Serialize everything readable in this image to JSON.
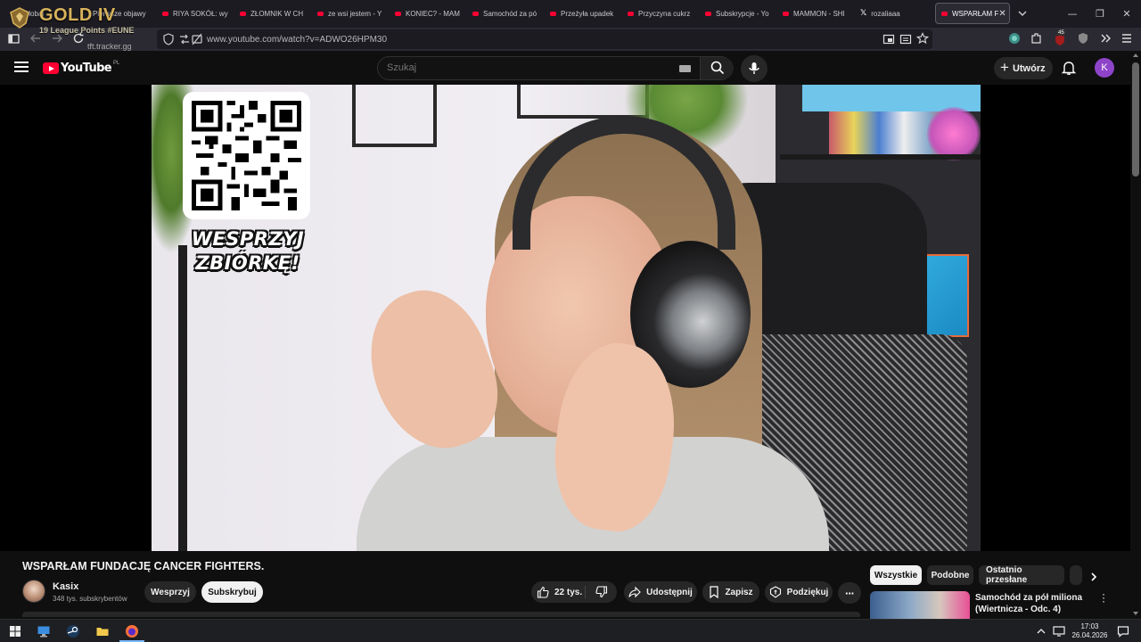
{
  "browser": {
    "tabs": [
      {
        "label": "Global",
        "type": "overlay"
      },
      {
        "label": "Pierwsze objawy",
        "type": "youtube"
      },
      {
        "label": "RIYA SOKÓŁ: wy",
        "type": "youtube"
      },
      {
        "label": "ZŁOMNIK W CH",
        "type": "youtube"
      },
      {
        "label": "ze wsi jestem - Y",
        "type": "youtube"
      },
      {
        "label": "KONIEC? - MAM",
        "type": "youtube"
      },
      {
        "label": "Samochód za pó",
        "type": "youtube"
      },
      {
        "label": "Przeżyła upadek",
        "type": "youtube"
      },
      {
        "label": "Przyczyna cukrz",
        "type": "youtube"
      },
      {
        "label": "Subskrypcje - Yo",
        "type": "youtube"
      },
      {
        "label": "MAMMON - SHI",
        "type": "youtube"
      },
      {
        "label": "rozaliaaa",
        "type": "x"
      },
      {
        "label": "WSPARŁAM F",
        "type": "youtube"
      }
    ],
    "active_tab_index": 12,
    "url": "www.youtube.com/watch?v=ADWO26HPM30",
    "tab_badge_count": "45"
  },
  "overlay": {
    "rank": "GOLD IV",
    "league_points": "19 League Points #EUNE",
    "site": "tft.tracker.gg"
  },
  "youtube": {
    "logo_text": "YouTube",
    "country_code": "PL",
    "search_placeholder": "Szukaj",
    "create_label": "Utwórz",
    "avatar_letter": "K"
  },
  "video": {
    "overlay_caption_line1": "WESPRZYJ",
    "overlay_caption_line2": "ZBIÓRKĘ!",
    "title": "WSPARŁAM FUNDACJĘ CANCER FIGHTERS.",
    "channel": "Kasix",
    "subscribers": "348 tys. subskrybentów",
    "support_label": "Wesprzyj",
    "subscribe_label": "Subskrybuj",
    "likes": "22 tys.",
    "share_label": "Udostępnij",
    "save_label": "Zapisz",
    "thanks_label": "Podziękuj"
  },
  "recommendations": {
    "chips": [
      "Wszystkie",
      "Podobne",
      "Ostatnio przesłane"
    ],
    "active_chip": 0,
    "items": [
      {
        "title": "Samochód za pół miliona (Wiertnicza - Odc. 4)"
      }
    ]
  },
  "taskbar": {
    "time": "17:03",
    "date": "26.04.2026"
  }
}
